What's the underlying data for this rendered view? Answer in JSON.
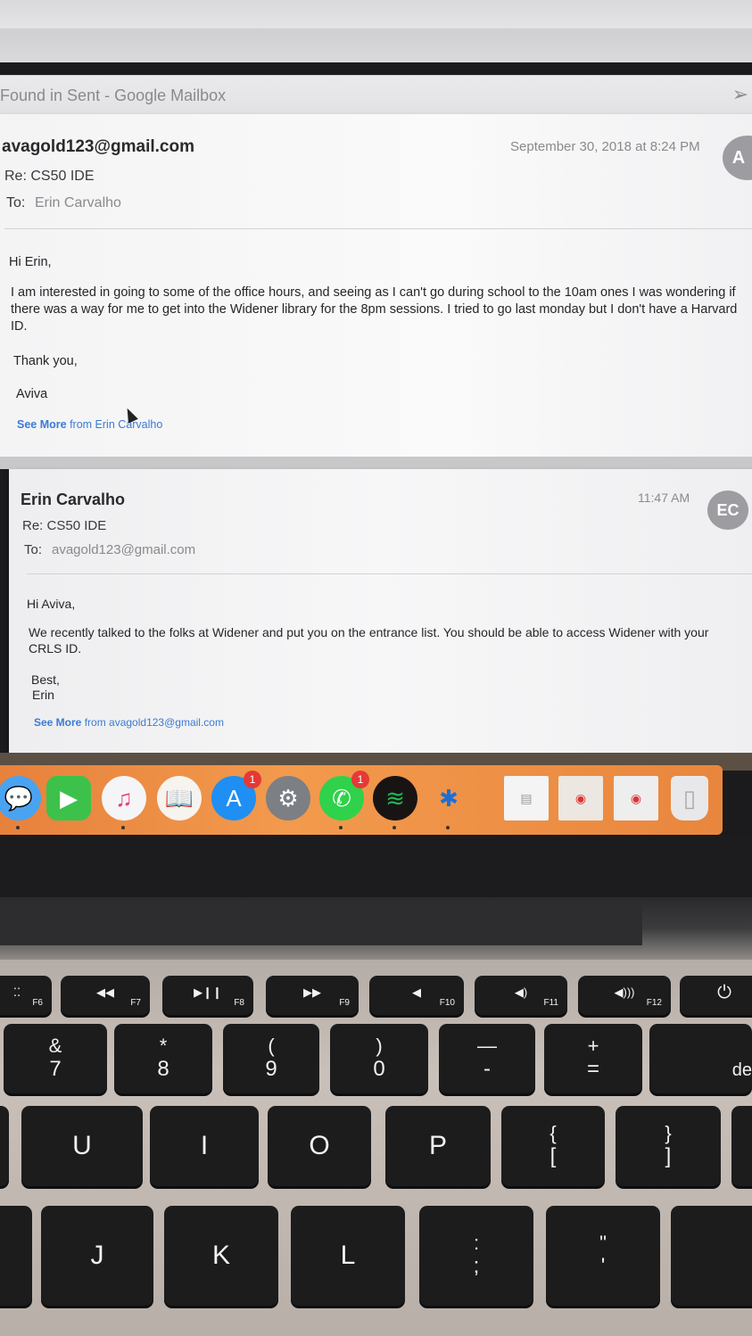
{
  "mail_window": {
    "title": "Found in Sent - Google Mailbox"
  },
  "messages": [
    {
      "from": "avagold123@gmail.com",
      "date": "September 30, 2018 at 8:24 PM",
      "subject": "Re: CS50 IDE",
      "to_label": "To:",
      "to": "Erin Carvalho",
      "avatar": "A",
      "greeting": "Hi Erin,",
      "body": "I am interested in going to some of the office hours, and seeing as I can't go during school to the 10am ones I was wondering if there was a way for me to get into the Widener library for the 8pm sessions. I tried to go last monday but I don't have a Harvard ID.",
      "closing": "Thank you,",
      "signature": "Aviva",
      "see_more_label": "See More",
      "see_more_from": "from Erin Carvalho"
    },
    {
      "from": "Erin Carvalho",
      "date": "11:47 AM",
      "subject": "Re: CS50 IDE",
      "to_label": "To:",
      "to": "avagold123@gmail.com",
      "avatar": "EC",
      "greeting": "Hi Aviva,",
      "body": "We recently talked to the folks at Widener and put you on the entrance list. You should be able to access Widener with your CRLS ID.",
      "closing": "Best,",
      "signature": "Erin",
      "see_more_label": "See More",
      "see_more_from": "from avagold123@gmail.com"
    }
  ],
  "dock": {
    "icons": [
      "messages-icon",
      "facetime-icon",
      "itunes-icon",
      "ibooks-icon",
      "app-store-icon",
      "system-preferences-icon",
      "whatsapp-icon",
      "spotify-icon",
      "bluetooth-file-exchange-icon",
      "document-preview-icon",
      "chrome-window-icon",
      "chrome-window-icon",
      "trash-icon"
    ],
    "app_store_badge": "1",
    "whatsapp_badge": "1"
  },
  "keyboard": {
    "function_row": [
      "F6",
      "F7",
      "F8",
      "F9",
      "F10",
      "F11",
      "F12"
    ],
    "number_row": [
      {
        "top": "&",
        "bottom": "7"
      },
      {
        "top": "*",
        "bottom": "8"
      },
      {
        "top": "(",
        "bottom": "9"
      },
      {
        "top": ")",
        "bottom": "0"
      },
      {
        "top": "—",
        "bottom": "-"
      },
      {
        "top": "+",
        "bottom": "="
      },
      {
        "top": "",
        "bottom": "de"
      }
    ],
    "top_letter_row": [
      "U",
      "I",
      "O",
      "P"
    ],
    "brackets": [
      {
        "top": "{",
        "bottom": "["
      },
      {
        "top": "}",
        "bottom": "]"
      }
    ],
    "home_row": [
      "J",
      "K",
      "L"
    ],
    "punct": [
      {
        "top": ":",
        "bottom": ";"
      },
      {
        "top": "\"",
        "bottom": "'"
      }
    ]
  }
}
